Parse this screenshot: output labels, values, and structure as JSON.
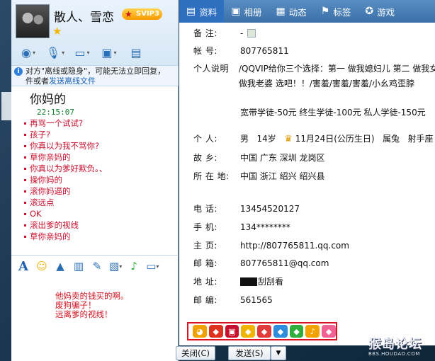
{
  "chat": {
    "nickname": "散人、雪恋",
    "vip_label": "SVIP3",
    "notice_prefix": "对方\"离线或隐身\"，可能无法立即回复，",
    "notice_mid": "件或者",
    "notice_link": "发送离线文件",
    "message_title": "你妈的",
    "message_time": "22:15:07",
    "messages": [
      "再骂一个试试?",
      "孩子?",
      "你真以为我不骂你?",
      "草你亲妈的",
      "你真以为爹好欺负。、",
      "操你妈的",
      "滚你妈逼的",
      "滚远点",
      "OK",
      "滚出爹的视线",
      "草你亲妈的"
    ],
    "compose_lines": [
      "他妈卖的钱买的啊。",
      "废狗骗子！",
      "远离爹的视线！"
    ],
    "buttons": {
      "close": "关闭(C)",
      "send": "发送(S)",
      "send_arrow": "▼"
    }
  },
  "info": {
    "tabs": [
      {
        "label": "资料",
        "icon": "profile-icon",
        "active": true
      },
      {
        "label": "相册",
        "icon": "album-icon",
        "active": false
      },
      {
        "label": "动态",
        "icon": "feed-icon",
        "active": false
      },
      {
        "label": "标签",
        "icon": "tag-icon",
        "active": false
      },
      {
        "label": "游戏",
        "icon": "game-icon",
        "active": false
      }
    ],
    "fields": {
      "remark": {
        "label": "备    注:",
        "value": "-"
      },
      "account": {
        "label": "帐    号:",
        "value": "807765811"
      },
      "bio_label": "个人说明",
      "bio_line1": "/QQVIP给你三个选择：第一 做我媳妇儿 第二 做我女朋友 第三",
      "bio_line2": "做我老婆 选吧！！/害羞/害羞/害羞/小幺鸡歪脖",
      "bio_line3": "宽带学徒-50元  终生学徒-100元  私人学徒-150元",
      "personal_label": "个    人:",
      "gender": "男",
      "age": "14岁",
      "birthday": "11月24日(公历生日)",
      "zodiac": "属兔",
      "constellation": "射手座",
      "hometown": {
        "label": "故    乡:",
        "value": "中国 广东 深圳 龙岗区"
      },
      "location": {
        "label": "所 在 地:",
        "value": "中国 浙江 绍兴 绍兴县"
      },
      "phone": {
        "label": "电    话:",
        "value": "13454520127"
      },
      "mobile": {
        "label": "手    机:",
        "value": "134********"
      },
      "homepage": {
        "label": "主    页:",
        "value": "http://807765811.qq.com"
      },
      "email": {
        "label": "邮    箱:",
        "value": "807765811@qq.com"
      },
      "address": {
        "label": "地    址:",
        "value": "刮刮看"
      },
      "postcode": {
        "label": "邮    编:",
        "value": "561565"
      }
    }
  },
  "badges": [
    {
      "icon": "penguin-icon",
      "color": "#f2a200"
    },
    {
      "icon": "red-diamond-icon",
      "color": "#e0301e"
    },
    {
      "icon": "qq-show-icon",
      "color": "#c8102e"
    },
    {
      "icon": "yellow-diamond-icon",
      "color": "#f0b400"
    },
    {
      "icon": "red-vip-icon",
      "color": "#e23a3a"
    },
    {
      "icon": "blue-diamond-icon",
      "color": "#2f8de0"
    },
    {
      "icon": "green-diamond-icon",
      "color": "#2fae3b"
    },
    {
      "icon": "music-icon",
      "color": "#f2a200"
    },
    {
      "icon": "pink-diamond-icon",
      "color": "#f06292"
    }
  ],
  "watermark": {
    "main": "猴岛论坛",
    "sub": "BBS.HOUDAO.COM"
  }
}
